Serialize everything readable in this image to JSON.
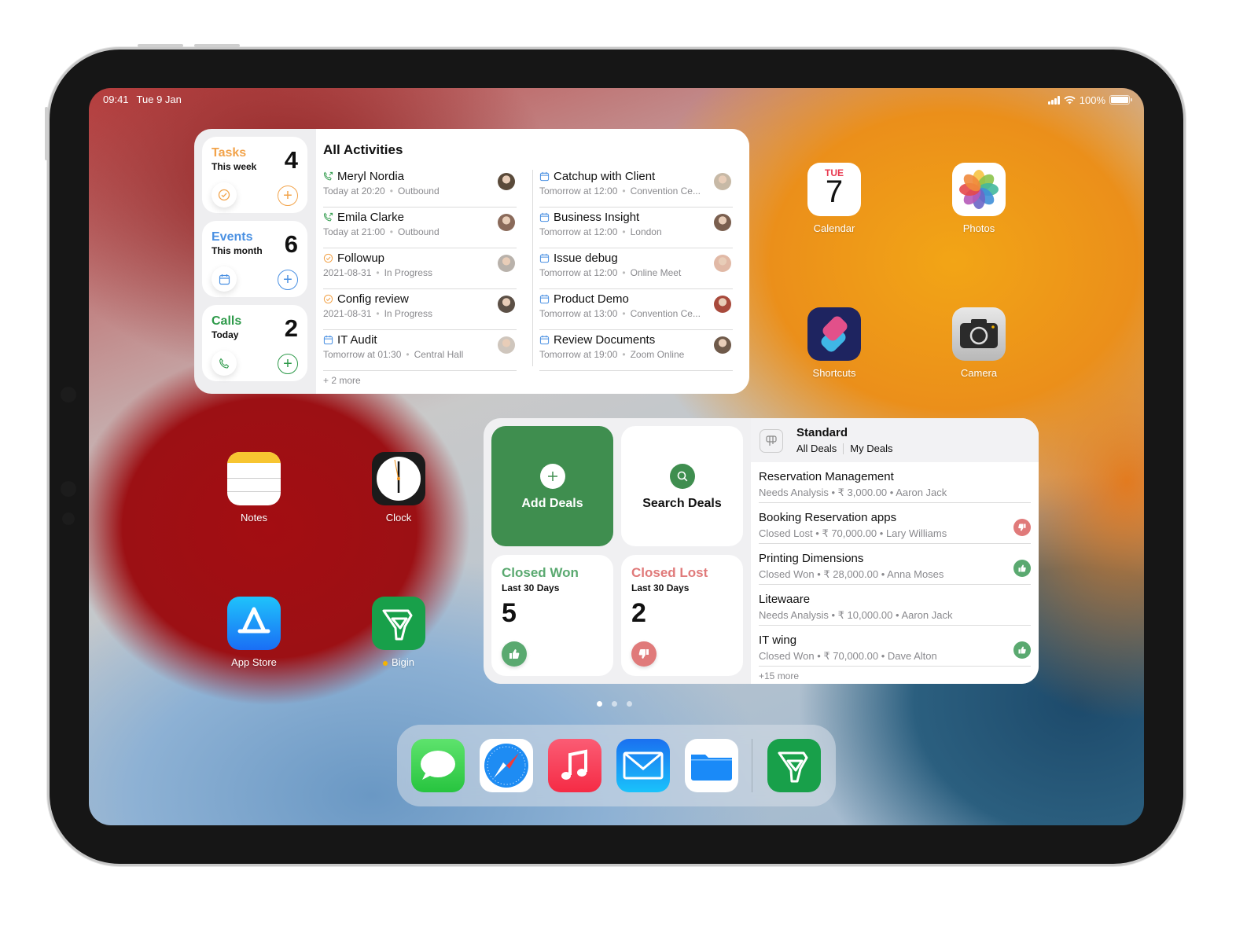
{
  "status_bar": {
    "time": "09:41",
    "date": "Tue 9 Jan",
    "battery": "100%"
  },
  "activities_widget": {
    "stats": [
      {
        "title": "Tasks",
        "subtitle": "This week",
        "count": "4",
        "color": "#f2a34a",
        "icon": "check-circle-icon"
      },
      {
        "title": "Events",
        "subtitle": "This month",
        "count": "6",
        "color": "#4a90e2",
        "icon": "calendar-icon"
      },
      {
        "title": "Calls",
        "subtitle": "Today",
        "count": "2",
        "color": "#2e9a4a",
        "icon": "phone-icon"
      }
    ],
    "title": "All Activities",
    "left_column": [
      {
        "name": "Meryl Nordia",
        "when": "Today at 20:20",
        "detail": "Outbound",
        "type": "call"
      },
      {
        "name": "Emila Clarke",
        "when": "Today at 21:00",
        "detail": "Outbound",
        "type": "call"
      },
      {
        "name": "Followup",
        "when": "2021-08-31",
        "detail": "In Progress",
        "type": "task"
      },
      {
        "name": "Config review",
        "when": "2021-08-31",
        "detail": "In Progress",
        "type": "task"
      },
      {
        "name": "IT Audit",
        "when": "Tomorrow at 01:30",
        "detail": "Central Hall",
        "type": "event"
      }
    ],
    "right_column": [
      {
        "name": "Catchup with Client",
        "when": "Tomorrow at 12:00",
        "detail": "Convention Ce...",
        "type": "event"
      },
      {
        "name": "Business Insight",
        "when": "Tomorrow at 12:00",
        "detail": "London",
        "type": "event"
      },
      {
        "name": "Issue debug",
        "when": "Tomorrow at 12:00",
        "detail": "Online Meet",
        "type": "event"
      },
      {
        "name": "Product Demo",
        "when": "Tomorrow at 13:00",
        "detail": "Convention Ce...",
        "type": "event"
      },
      {
        "name": "Review Documents",
        "when": "Tomorrow at 19:00",
        "detail": "Zoom Online",
        "type": "event"
      }
    ],
    "more": "+ 2 more"
  },
  "apps": {
    "calendar": {
      "label": "Calendar",
      "day": "TUE",
      "date": "7"
    },
    "photos": {
      "label": "Photos"
    },
    "shortcuts": {
      "label": "Shortcuts"
    },
    "camera": {
      "label": "Camera"
    },
    "notes": {
      "label": "Notes"
    },
    "clock": {
      "label": "Clock"
    },
    "appstore": {
      "label": "App Store"
    },
    "bigin": {
      "label": "Bigin"
    }
  },
  "deals_widget": {
    "add_label": "Add Deals",
    "search_label": "Search Deals",
    "closed_won": {
      "title": "Closed Won",
      "subtitle": "Last 30 Days",
      "count": "5",
      "color": "#5aa970"
    },
    "closed_lost": {
      "title": "Closed Lost",
      "subtitle": "Last 30 Days",
      "count": "2",
      "color": "#e07a7a"
    },
    "pipeline": "Standard",
    "tabs": [
      "All Deals",
      "My Deals"
    ],
    "deals": [
      {
        "name": "Reservation Management",
        "stage": "Needs Analysis",
        "amount": "₹ 3,000.00",
        "owner": "Aaron Jack",
        "badge": ""
      },
      {
        "name": "Booking Reservation apps",
        "stage": "Closed Lost",
        "amount": "₹ 70,000.00",
        "owner": "Lary Williams",
        "badge": "lost"
      },
      {
        "name": "Printing Dimensions",
        "stage": "Closed Won",
        "amount": "₹ 28,000.00",
        "owner": "Anna Moses",
        "badge": "won"
      },
      {
        "name": "Litewaare",
        "stage": "Needs Analysis",
        "amount": "₹ 10,000.00",
        "owner": "Aaron Jack",
        "badge": ""
      },
      {
        "name": "IT wing",
        "stage": "Closed Won",
        "amount": "₹ 70,000.00",
        "owner": "Dave Alton",
        "badge": "won"
      }
    ],
    "more": "+15 more"
  },
  "page_dots": {
    "count": 3,
    "active": 0
  },
  "dock": [
    "Messages",
    "Safari",
    "Music",
    "Mail",
    "Files",
    "Bigin"
  ]
}
